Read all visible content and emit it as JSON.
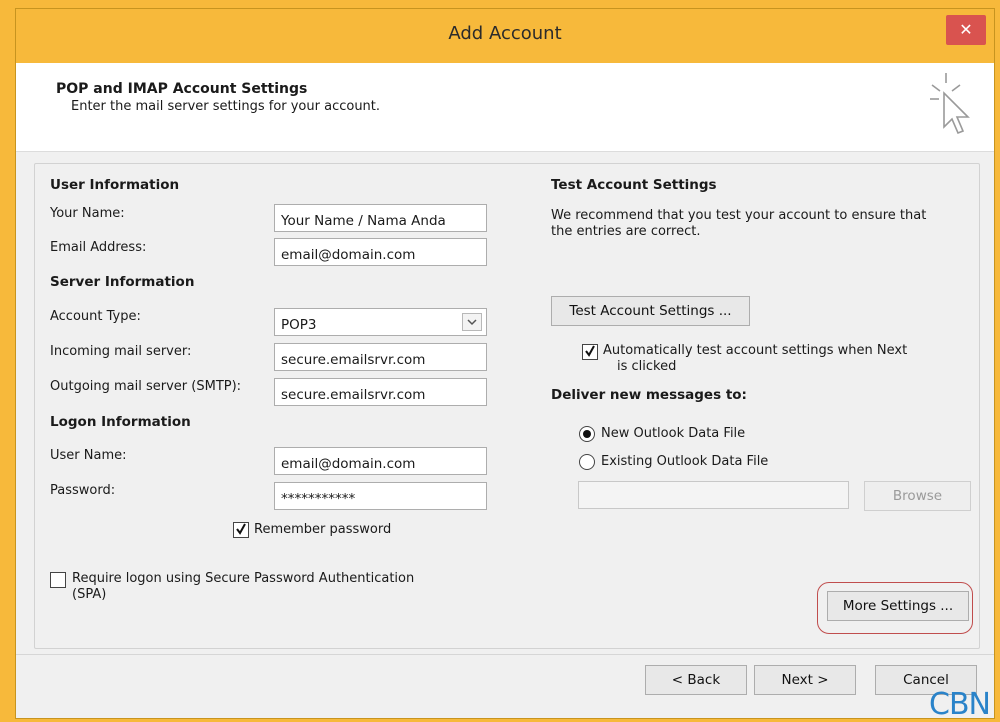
{
  "window": {
    "title": "Add Account",
    "close_glyph": "✕"
  },
  "header": {
    "title": "POP and IMAP Account Settings",
    "subtitle": "Enter the mail server settings for your account.",
    "icon": "wizard-cursor-icon"
  },
  "user_info": {
    "section": "User Information",
    "name_label": "Your Name:",
    "name_value": "Your Name / Nama Anda",
    "email_label": "Email Address:",
    "email_value": "email@domain.com"
  },
  "server_info": {
    "section": "Server Information",
    "account_type_label": "Account Type:",
    "account_type_value": "POP3",
    "incoming_label": "Incoming mail server:",
    "incoming_value": "secure.emailsrvr.com",
    "outgoing_label": "Outgoing mail server (SMTP):",
    "outgoing_value": "secure.emailsrvr.com"
  },
  "logon_info": {
    "section": "Logon Information",
    "username_label": "User Name:",
    "username_value": "email@domain.com",
    "password_label": "Password:",
    "password_value": "***********",
    "remember_label": "Remember password",
    "remember_checked": true,
    "spa_label_line1": "Require logon using Secure Password Authentication",
    "spa_label_line2": "(SPA)",
    "spa_checked": false
  },
  "test": {
    "section": "Test Account Settings",
    "desc_line1": "We recommend that you test your account to ensure that",
    "desc_line2": "the entries are correct.",
    "button": "Test Account Settings ...",
    "auto_line1": "Automatically test account settings when Next",
    "auto_line2": "is clicked",
    "auto_checked": true
  },
  "deliver": {
    "section": "Deliver new messages to:",
    "option_new": "New Outlook Data File",
    "option_existing": "Existing Outlook Data File",
    "selected": "new",
    "browse": "Browse"
  },
  "more_settings": "More Settings ...",
  "footer": {
    "back": "< Back",
    "next": "Next >",
    "cancel": "Cancel"
  },
  "watermark": "CBN",
  "colors": {
    "title_bar": "#f7b93b",
    "close": "#d9534f",
    "highlight": "#c04d4d",
    "watermark": "#2a83c9"
  }
}
